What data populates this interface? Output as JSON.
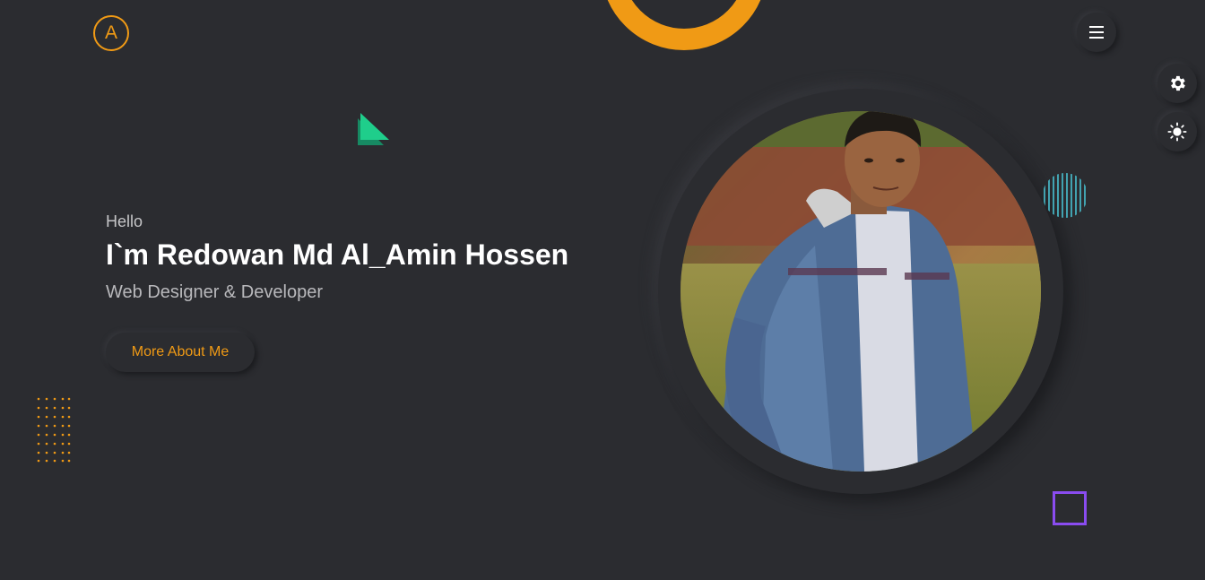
{
  "header": {
    "logo_letter": "A",
    "menu_icon": "hamburger-icon"
  },
  "side_controls": {
    "settings_icon": "gear-icon",
    "theme_icon": "sun-icon"
  },
  "hero": {
    "greeting": "Hello",
    "name": "I`m Redowan Md Al_Amin Hossen",
    "role": "Web Designer & Developer",
    "cta_label": "More About Me"
  },
  "colors": {
    "background": "#2b2c30",
    "accent_orange": "#f09a15",
    "accent_green": "#1fce8b",
    "accent_purple": "#8a4cf0",
    "accent_cyan": "#49c1d1"
  }
}
